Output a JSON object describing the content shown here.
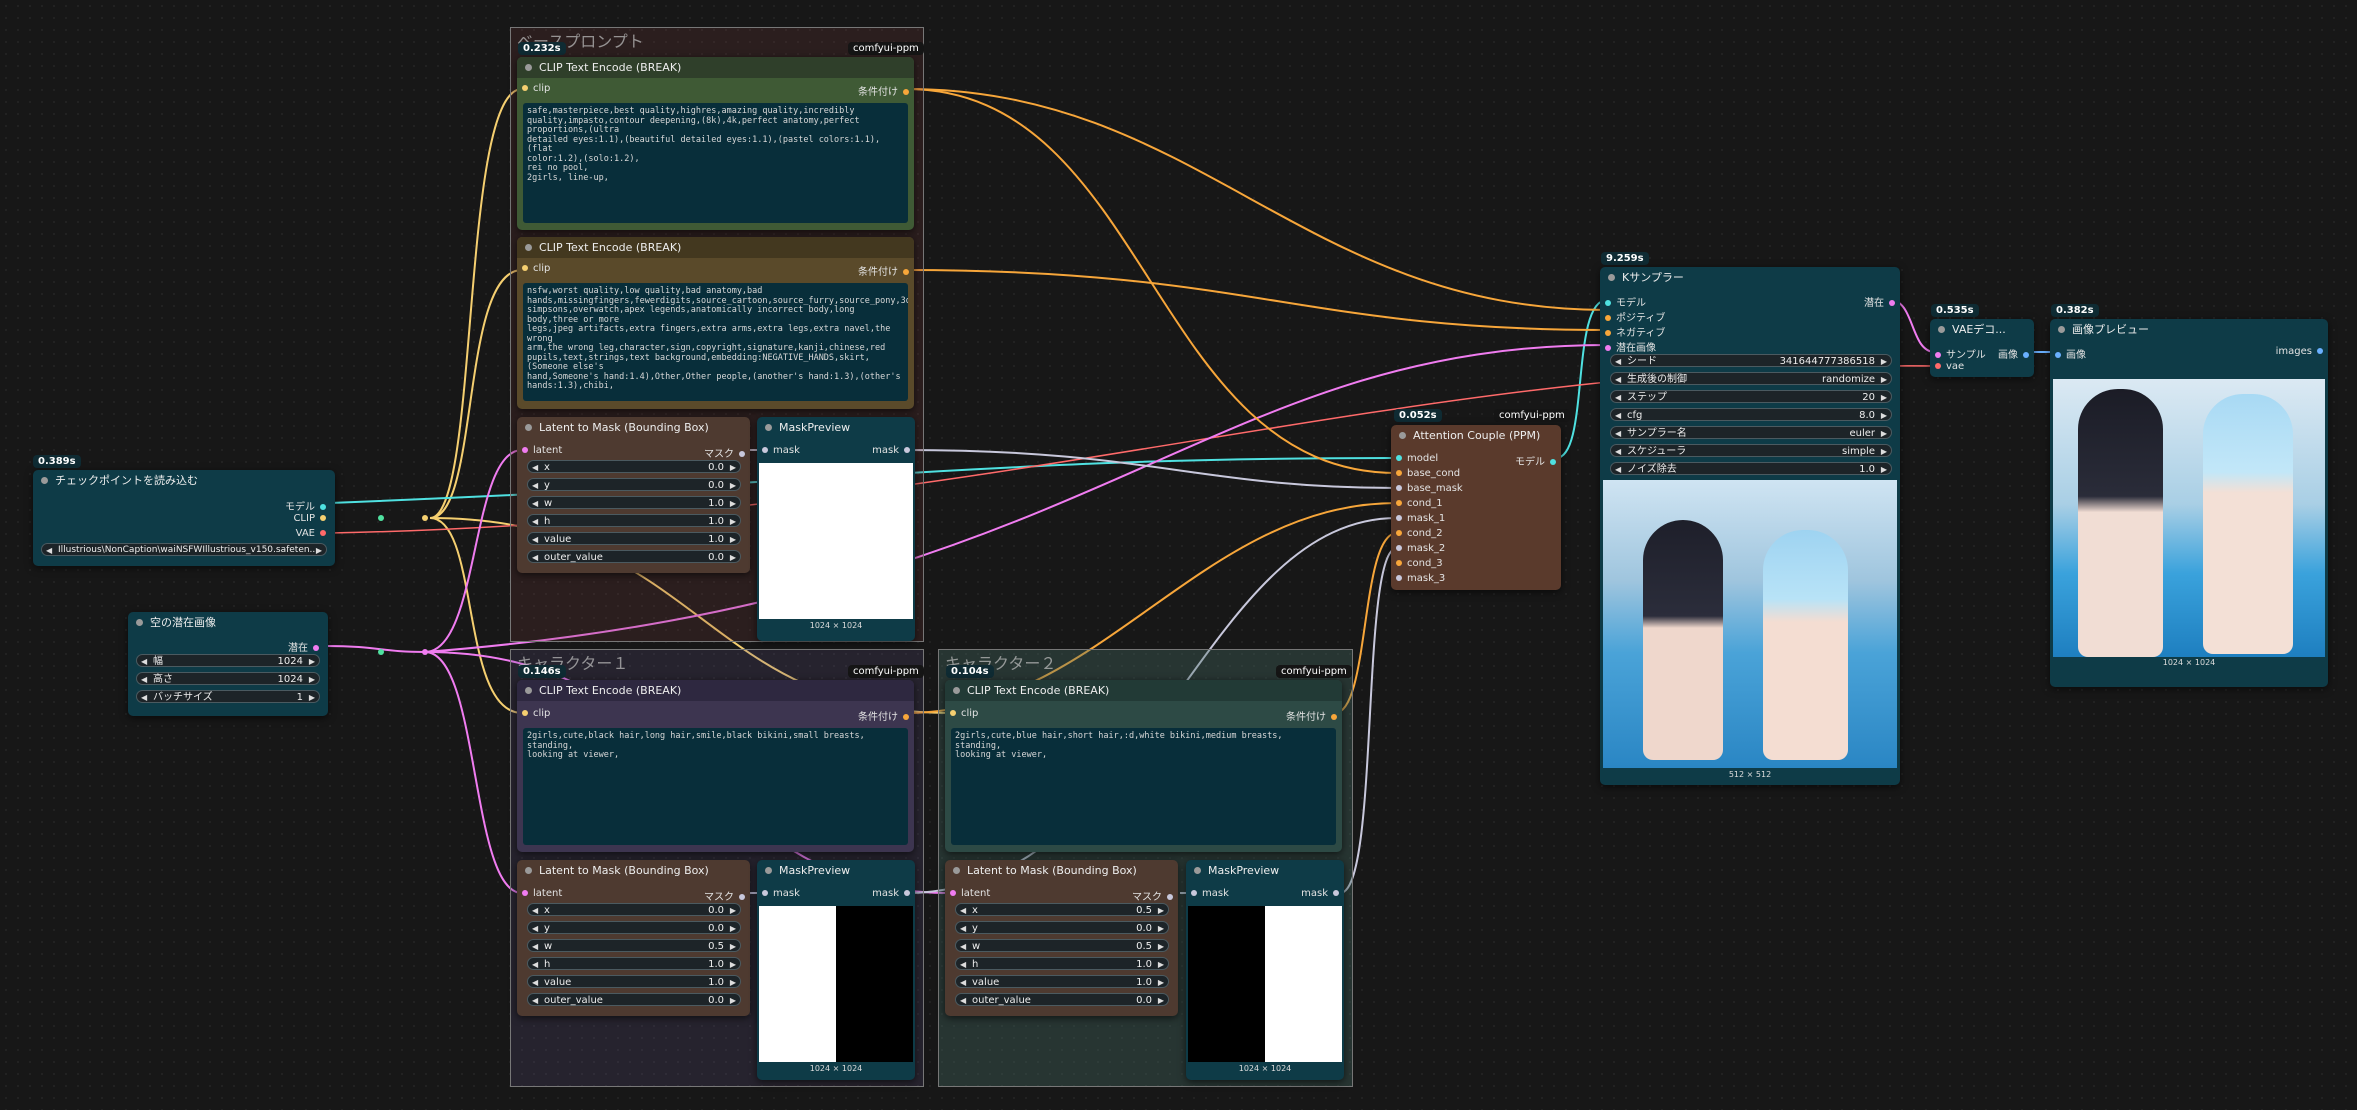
{
  "groups": {
    "base": "ベースプロンプト",
    "char1": "キャラクター１",
    "char2": "キャラクター２"
  },
  "tag": "comfyui-ppm",
  "checkpoint": {
    "time": "0.389s",
    "title": "チェックポイントを読み込む",
    "out_model": "モデル",
    "out_clip": "CLIP",
    "out_vae": "VAE",
    "ckpt": "Illustrious\\NonCaption\\waiNSFWIllustrious_v150.safeten..."
  },
  "latent": {
    "title": "空の潜在画像",
    "out": "潜在",
    "width_label": "幅",
    "width": "1024",
    "height_label": "高さ",
    "height": "1024",
    "batch_label": "バッチサイズ",
    "batch": "1"
  },
  "clip_pos": {
    "time": "0.232s",
    "title": "CLIP Text Encode (BREAK)",
    "in": "clip",
    "out": "条件付け",
    "text": "safe,masterpiece,best quality,highres,amazing quality,incredibly\nquality,impasto,contour deepening,(8k),4k,perfect anatomy,perfect proportions,(ultra\ndetailed eyes:1.1),(beautiful detailed eyes:1.1),(pastel colors:1.1),(flat\ncolor:1.2),(solo:1.2),\nrei no pool,\n2girls, line-up,"
  },
  "clip_neg": {
    "title": "CLIP Text Encode (BREAK)",
    "in": "clip",
    "out": "条件付け",
    "text": "nsfw,worst quality,low quality,bad anatomy,bad\nhands,missingfingers,fewerdigits,source_cartoon,source_furry,source_pony,3d,the\nsimpsons,overwatch,apex legends,anatomically incorrect body,long body,three or more\nlegs,jpeg artifacts,extra fingers,extra arms,extra legs,extra navel,the wrong\narm,the wrong leg,character,sign,copyright,signature,kanji,chinese,red\npupils,text,strings,text background,embedding:NEGATIVE_HANDS,skirt,(Someone else's\nhand,Someone's hand:1.4),Other,Other people,(another's hand:1.3),(other's\nhands:1.3),chibi,"
  },
  "mask_base": {
    "title": "Latent to Mask (Bounding Box)",
    "in": "latent",
    "out": "マスク",
    "x": "0.0",
    "y": "0.0",
    "w": "1.0",
    "h": "1.0",
    "value": "1.0",
    "outer_value": "0.0"
  },
  "preview_base": {
    "title": "MaskPreview",
    "in": "mask",
    "out": "mask",
    "caption": "1024 × 1024"
  },
  "attention": {
    "time": "0.052s",
    "title": "Attention Couple (PPM)",
    "out": "モデル",
    "inputs": [
      "model",
      "base_cond",
      "base_mask",
      "cond_1",
      "mask_1",
      "cond_2",
      "mask_2",
      "cond_3",
      "mask_3"
    ]
  },
  "ksampler": {
    "time": "9.259s",
    "title": "Kサンプラー",
    "out": "潜在",
    "inputs": [
      "モデル",
      "ポジティブ",
      "ネガティブ",
      "潜在画像"
    ],
    "widgets": [
      {
        "label": "シード",
        "value": "341644777386518"
      },
      {
        "label": "生成後の制御",
        "value": "randomize"
      },
      {
        "label": "ステップ",
        "value": "20"
      },
      {
        "label": "cfg",
        "value": "8.0"
      },
      {
        "label": "サンプラー名",
        "value": "euler"
      },
      {
        "label": "スケジューラ",
        "value": "simple"
      },
      {
        "label": "ノイズ除去",
        "value": "1.0"
      }
    ],
    "caption": "512 × 512"
  },
  "vae": {
    "time": "0.535s",
    "title": "VAEデコ...",
    "in1": "サンプル",
    "in2": "vae",
    "out": "画像"
  },
  "imgpreview": {
    "time": "0.382s",
    "title": "画像プレビュー",
    "in": "画像",
    "out": "images",
    "caption": "1024 × 1024"
  },
  "clip_c1": {
    "time": "0.146s",
    "title": "CLIP Text Encode (BREAK)",
    "in": "clip",
    "out": "条件付け",
    "text": "2girls,cute,black hair,long hair,smile,black bikini,small breasts,\nstanding,\nlooking at viewer,"
  },
  "mask_c1": {
    "title": "Latent to Mask (Bounding Box)",
    "in": "latent",
    "out": "マスク",
    "x": "0.0",
    "y": "0.0",
    "w": "0.5",
    "h": "1.0",
    "value": "1.0",
    "outer_value": "0.0"
  },
  "preview_c1": {
    "title": "MaskPreview",
    "in": "mask",
    "out": "mask",
    "caption": "1024 × 1024"
  },
  "clip_c2": {
    "time": "0.104s",
    "title": "CLIP Text Encode (BREAK)",
    "in": "clip",
    "out": "条件付け",
    "text": "2girls,cute,blue hair,short hair,:d,white bikini,medium breasts,\nstanding,\nlooking at viewer,"
  },
  "mask_c2": {
    "title": "Latent to Mask (Bounding Box)",
    "in": "latent",
    "out": "マスク",
    "x": "0.5",
    "y": "0.0",
    "w": "0.5",
    "h": "1.0",
    "value": "1.0",
    "outer_value": "0.0"
  },
  "preview_c2": {
    "title": "MaskPreview",
    "in": "mask",
    "out": "mask",
    "caption": "1024 × 1024"
  },
  "colors": {
    "node_teal": "#0e3b47",
    "node_brown": "#4e3a30",
    "node_green": "#3f5a35",
    "node_olive": "#5a4a2a",
    "node_purple": "#3d3550",
    "link_model": "#4fe1e1",
    "link_clip": "#f5cf70",
    "link_cond": "#f7a63a",
    "link_latent": "#f07cf0",
    "link_mask": "#c8c8dc",
    "link_vae": "#ff6a6a"
  }
}
